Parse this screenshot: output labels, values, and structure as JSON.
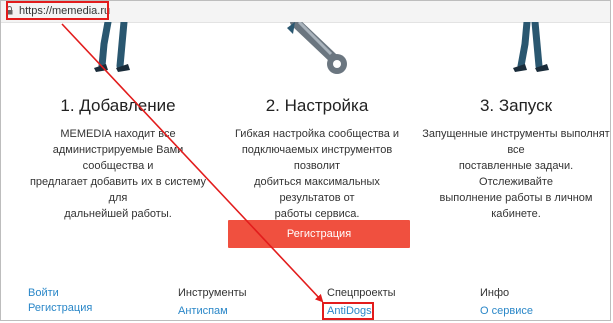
{
  "browser": {
    "url": "https://memedia.ru"
  },
  "steps": [
    {
      "title": "1. Добавление",
      "lines": [
        "MEMEDIA находит все",
        "администрируемые Вами сообщества и",
        "предлагает добавить их в систему для",
        "дальнейшей работы."
      ]
    },
    {
      "title": "2. Настройка",
      "lines": [
        "Гибкая настройка сообщества и",
        "подключаемых инструментов позволит",
        "добиться максимальных результатов от",
        "работы сервиса."
      ]
    },
    {
      "title": "3. Запуск",
      "lines": [
        "Запущенные инструменты выполнят все",
        "поставленные задачи. Отслеживайте",
        "выполнение работы в личном кабинете."
      ]
    }
  ],
  "register_button": "Регистрация",
  "footer": {
    "col1": {
      "links": [
        "Войти",
        "Регистрация"
      ]
    },
    "col2": {
      "heading": "Инструменты",
      "links": [
        "Антиспам"
      ]
    },
    "col3": {
      "heading": "Спецпроекты",
      "links": [
        "AntiDogs"
      ]
    },
    "col4": {
      "heading": "Инфо",
      "links": [
        "О сервисе"
      ]
    }
  },
  "colors": {
    "accent": "#f0503f",
    "link": "#2a87c8",
    "annotation": "#e21c1c"
  }
}
